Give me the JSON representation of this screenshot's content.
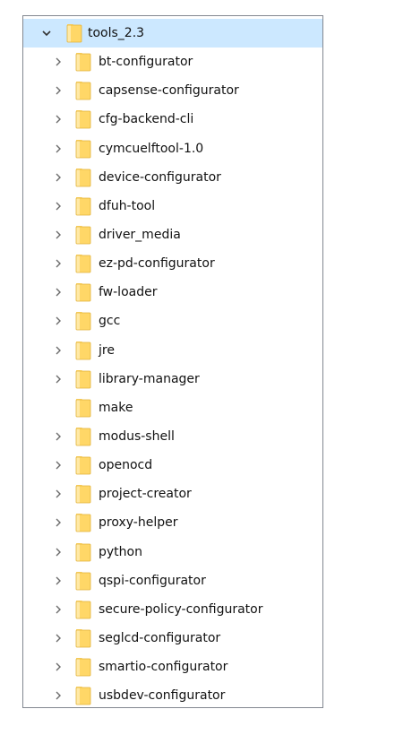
{
  "tree": {
    "root": {
      "label": "tools_2.3",
      "expanded": true,
      "selected": true
    },
    "children": [
      {
        "label": "bt-configurator",
        "has_children": true
      },
      {
        "label": "capsense-configurator",
        "has_children": true
      },
      {
        "label": "cfg-backend-cli",
        "has_children": true
      },
      {
        "label": "cymcuelftool-1.0",
        "has_children": true
      },
      {
        "label": "device-configurator",
        "has_children": true
      },
      {
        "label": "dfuh-tool",
        "has_children": true
      },
      {
        "label": "driver_media",
        "has_children": true
      },
      {
        "label": "ez-pd-configurator",
        "has_children": true
      },
      {
        "label": "fw-loader",
        "has_children": true
      },
      {
        "label": "gcc",
        "has_children": true
      },
      {
        "label": "jre",
        "has_children": true
      },
      {
        "label": "library-manager",
        "has_children": true
      },
      {
        "label": "make",
        "has_children": false
      },
      {
        "label": "modus-shell",
        "has_children": true
      },
      {
        "label": "openocd",
        "has_children": true
      },
      {
        "label": "project-creator",
        "has_children": true
      },
      {
        "label": "proxy-helper",
        "has_children": true
      },
      {
        "label": "python",
        "has_children": true
      },
      {
        "label": "qspi-configurator",
        "has_children": true
      },
      {
        "label": "secure-policy-configurator",
        "has_children": true
      },
      {
        "label": "seglcd-configurator",
        "has_children": true
      },
      {
        "label": "smartio-configurator",
        "has_children": true
      },
      {
        "label": "usbdev-configurator",
        "has_children": true
      }
    ]
  },
  "colors": {
    "selection": "#cce8ff",
    "folder_body": "#ffd767",
    "folder_light": "#ffe9a6",
    "chevron": "#6b6b6b",
    "border": "#828790"
  },
  "icons": {
    "expand": "chevron-right-icon",
    "collapse": "chevron-down-icon",
    "folder": "folder-icon"
  }
}
